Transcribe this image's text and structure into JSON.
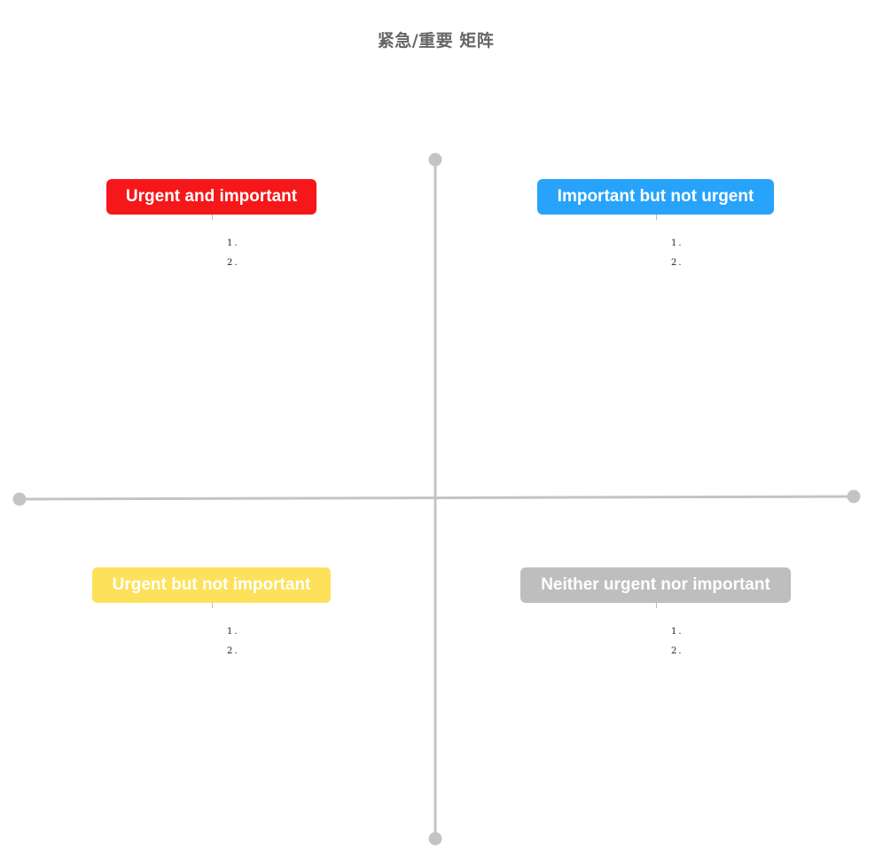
{
  "title": "紧急/重要 矩阵",
  "quadrants": {
    "top_left": {
      "label": "Urgent and important",
      "color": "#f5171a",
      "items": [
        "1.",
        "2."
      ]
    },
    "top_right": {
      "label": "Important but not urgent",
      "color": "#27a3fb",
      "items": [
        "1.",
        "2."
      ]
    },
    "bottom_left": {
      "label": "Urgent but not important",
      "color": "#fde15a",
      "items": [
        "1.",
        "2."
      ]
    },
    "bottom_right": {
      "label": "Neither urgent nor important",
      "color": "#bebebe",
      "items": [
        "1.",
        "2."
      ]
    }
  },
  "axis_color": "#c4c4c4"
}
